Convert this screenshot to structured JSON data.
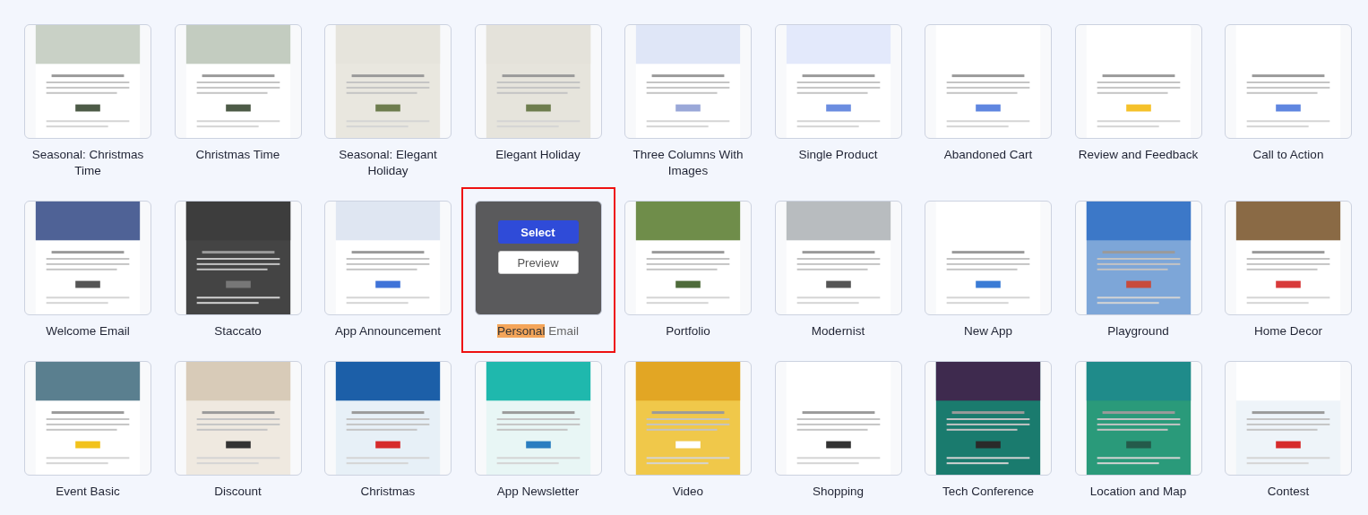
{
  "templates": [
    {
      "label": [
        {
          "text": "Seasonal: Christmas Time",
          "highlighted": false
        }
      ],
      "selected": false
    },
    {
      "label": [
        {
          "text": "Christmas Time",
          "highlighted": false
        }
      ],
      "selected": false
    },
    {
      "label": [
        {
          "text": "Seasonal: Elegant Holiday",
          "highlighted": false
        }
      ],
      "selected": false
    },
    {
      "label": [
        {
          "text": "Elegant Holiday",
          "highlighted": false
        }
      ],
      "selected": false
    },
    {
      "label": [
        {
          "text": "Three Columns With Images",
          "highlighted": false
        }
      ],
      "selected": false
    },
    {
      "label": [
        {
          "text": "Single Product",
          "highlighted": false
        }
      ],
      "selected": false
    },
    {
      "label": [
        {
          "text": "Abandoned Cart",
          "highlighted": false
        }
      ],
      "selected": false
    },
    {
      "label": [
        {
          "text": "Review and Feedback",
          "highlighted": false
        }
      ],
      "selected": false
    },
    {
      "label": [
        {
          "text": "Call to Action",
          "highlighted": false
        }
      ],
      "selected": false
    },
    {
      "label": [
        {
          "text": "Welcome Email",
          "highlighted": false
        }
      ],
      "selected": false
    },
    {
      "label": [
        {
          "text": "Staccato",
          "highlighted": false
        }
      ],
      "selected": false
    },
    {
      "label": [
        {
          "text": "App Announcement",
          "highlighted": false
        }
      ],
      "selected": false
    },
    {
      "label": [
        {
          "text": "Personal",
          "highlighted": true
        },
        {
          "text": " Email",
          "highlighted": false
        }
      ],
      "selected": true,
      "actions": [
        "Select",
        "Preview"
      ]
    },
    {
      "label": [
        {
          "text": "Portfolio",
          "highlighted": false
        }
      ],
      "selected": false
    },
    {
      "label": [
        {
          "text": "Modernist",
          "highlighted": false
        }
      ],
      "selected": false
    },
    {
      "label": [
        {
          "text": "New App",
          "highlighted": false
        }
      ],
      "selected": false
    },
    {
      "label": [
        {
          "text": "Playground",
          "highlighted": false
        }
      ],
      "selected": false
    },
    {
      "label": [
        {
          "text": "Home Decor",
          "highlighted": false
        }
      ],
      "selected": false
    },
    {
      "label": [
        {
          "text": "Event Basic",
          "highlighted": false
        }
      ],
      "selected": false
    },
    {
      "label": [
        {
          "text": "Discount",
          "highlighted": false
        }
      ],
      "selected": false
    },
    {
      "label": [
        {
          "text": "Christmas",
          "highlighted": false
        }
      ],
      "selected": false
    },
    {
      "label": [
        {
          "text": "App Newsletter",
          "highlighted": false
        }
      ],
      "selected": false
    },
    {
      "label": [
        {
          "text": "Video",
          "highlighted": false
        }
      ],
      "selected": false
    },
    {
      "label": [
        {
          "text": "Shopping",
          "highlighted": false
        }
      ],
      "selected": false
    },
    {
      "label": [
        {
          "text": "Tech Conference",
          "highlighted": false
        }
      ],
      "selected": false
    },
    {
      "label": [
        {
          "text": "Location and Map",
          "highlighted": false
        }
      ],
      "selected": false
    },
    {
      "label": [
        {
          "text": "Contest",
          "highlighted": false
        }
      ],
      "selected": false
    }
  ]
}
